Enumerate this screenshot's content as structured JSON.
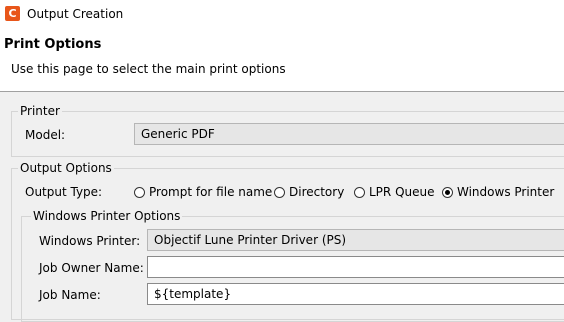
{
  "window": {
    "icon_letter": "C",
    "title": "Output Creation"
  },
  "header": {
    "title": "Print Options",
    "description": "Use this page to select the main print options"
  },
  "printer": {
    "legend": "Printer",
    "model_label": "Model:",
    "model_value": "Generic PDF"
  },
  "output_options": {
    "legend": "Output Options",
    "output_type_label": "Output Type:",
    "types": [
      {
        "label": "Prompt for file name",
        "checked": false
      },
      {
        "label": "Directory",
        "checked": false
      },
      {
        "label": "LPR Queue",
        "checked": false
      },
      {
        "label": "Windows Printer",
        "checked": true
      }
    ]
  },
  "windows_printer_options": {
    "legend": "Windows Printer Options",
    "printer_label": "Windows Printer:",
    "printer_value": "Objectif Lune Printer Driver (PS)",
    "job_owner_label": "Job Owner Name:",
    "job_owner_value": "",
    "job_name_label": "Job Name:",
    "job_name_value": "${template}"
  }
}
